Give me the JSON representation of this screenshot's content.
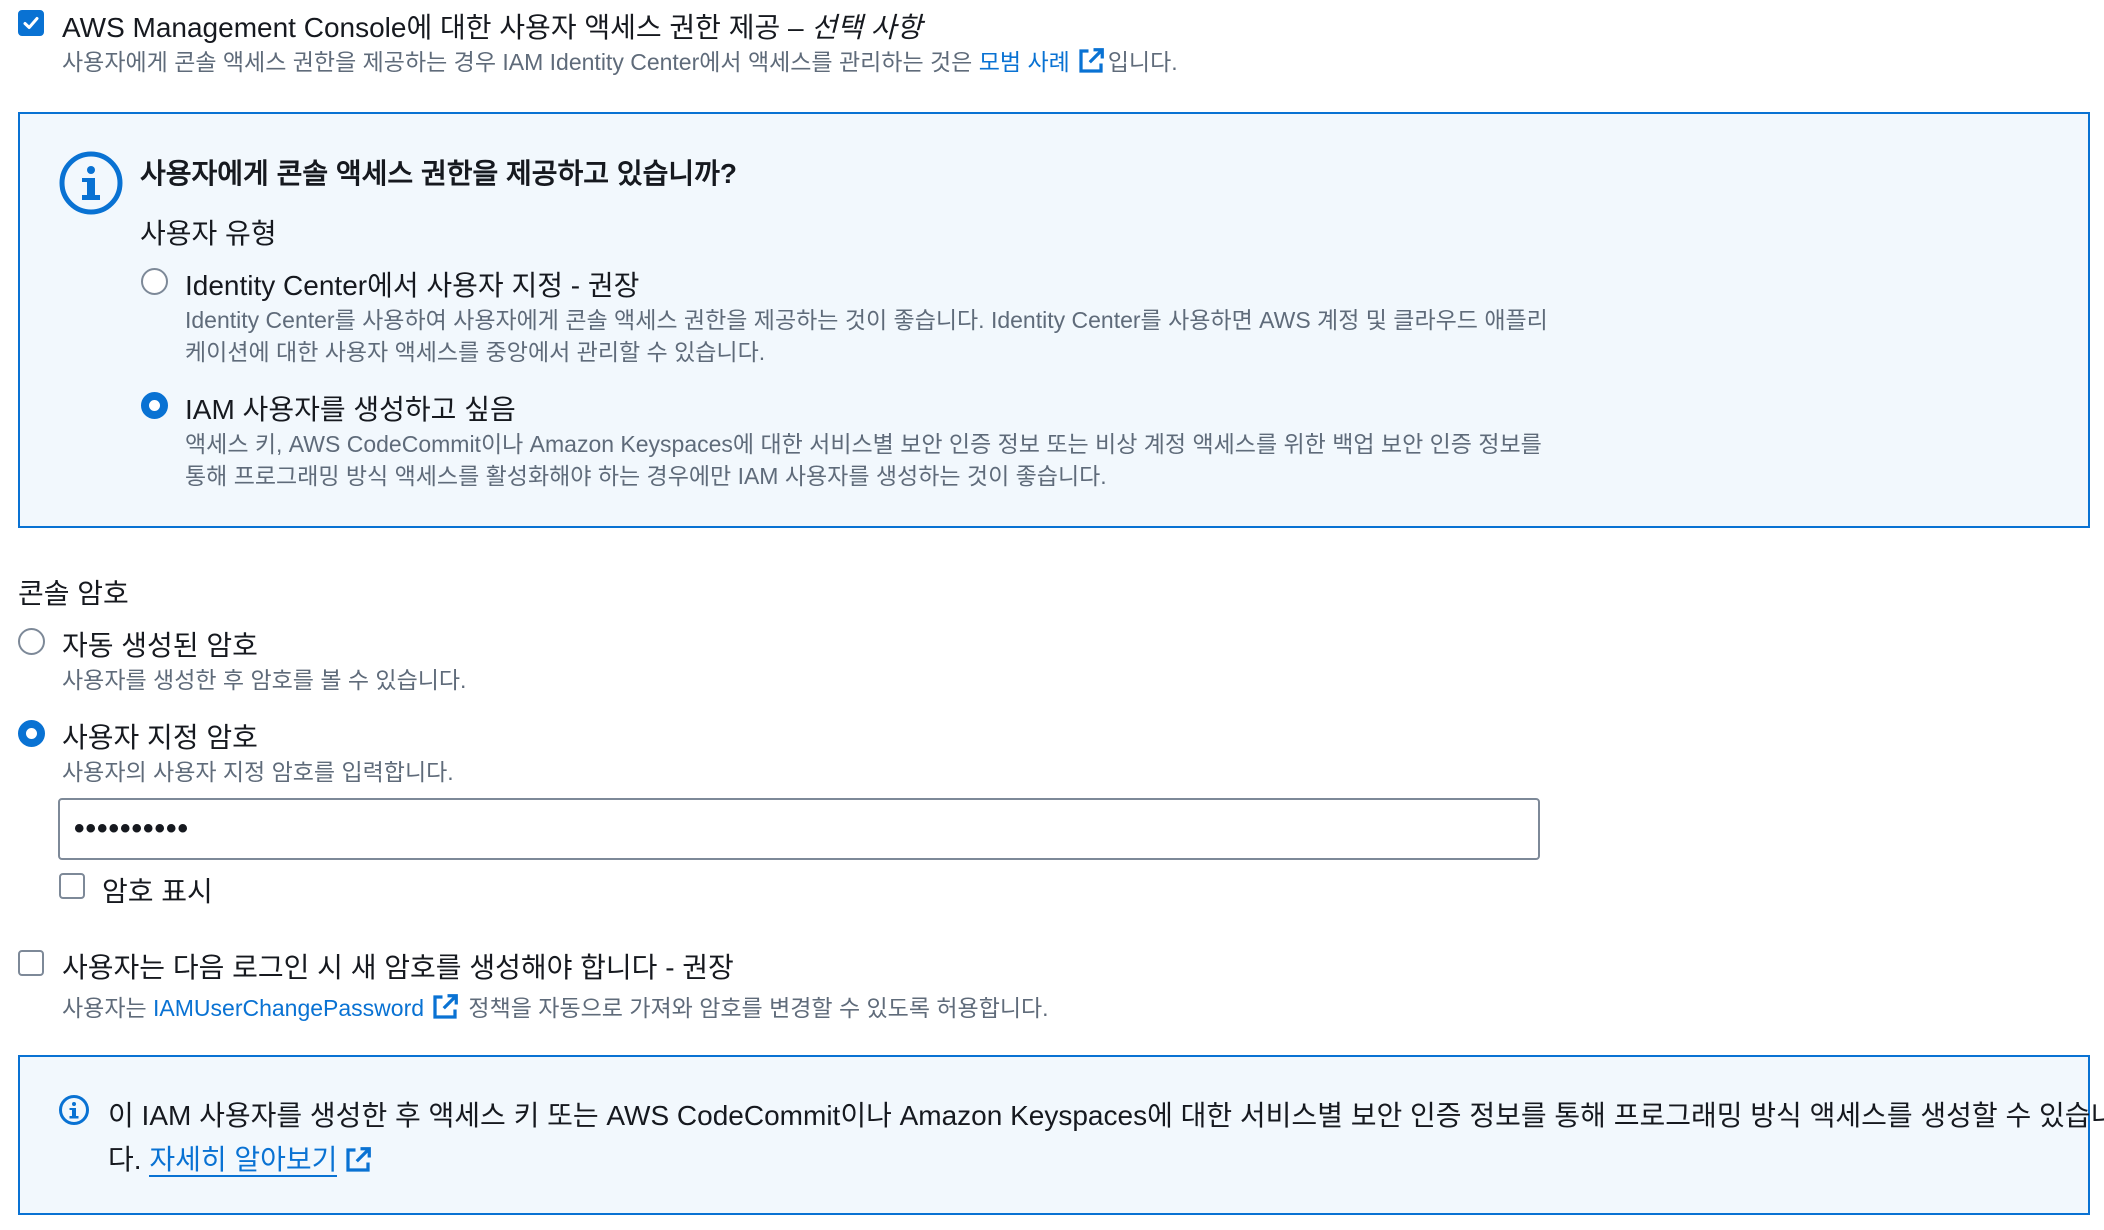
{
  "console_access": {
    "checked": true,
    "label": "AWS Management Console에 대한 사용자 액세스 권한 제공 – ",
    "label_optional": "선택 사항",
    "desc_prefix": "사용자에게 콘솔 액세스 권한을 제공하는 경우 IAM Identity Center에서 액세스를 관리하는 것은 ",
    "desc_link": "모범 사례",
    "desc_suffix": "입니다."
  },
  "info_panel": {
    "title": "사용자에게 콘솔 액세스 권한을 제공하고 있습니까?",
    "user_type_label": "사용자 유형",
    "options": [
      {
        "label": "Identity Center에서 사용자 지정 - 권장",
        "selected": false,
        "desc_line1": "Identity Center를 사용하여 사용자에게 콘솔 액세스 권한을 제공하는 것이 좋습니다. Identity Center를 사용하면 AWS 계정 및 클라우드 애플리",
        "desc_line2": "케이션에 대한 사용자 액세스를 중앙에서 관리할 수 있습니다."
      },
      {
        "label": "IAM 사용자를 생성하고 싶음",
        "selected": true,
        "desc_line1": "액세스 키, AWS CodeCommit이나 Amazon Keyspaces에 대한 서비스별 보안 인증 정보 또는 비상 계정 액세스를 위한 백업 보안 인증 정보를",
        "desc_line2": "통해 프로그래밍 방식 액세스를 활성화해야 하는 경우에만 IAM 사용자를 생성하는 것이 좋습니다."
      }
    ]
  },
  "console_password": {
    "heading": "콘솔 암호",
    "options": [
      {
        "label": "자동 생성된 암호",
        "desc": "사용자를 생성한 후 암호를 볼 수 있습니다.",
        "selected": false
      },
      {
        "label": "사용자 지정 암호",
        "desc": "사용자의 사용자 지정 암호를 입력합니다.",
        "selected": true
      }
    ],
    "password_value": "••••••••••",
    "show_password_label": "암호 표시",
    "show_password_checked": false
  },
  "require_reset": {
    "checked": false,
    "label": "사용자는 다음 로그인 시 새 암호를 생성해야 합니다 - 권장",
    "desc_prefix": "사용자는 ",
    "desc_link": "IAMUserChangePassword",
    "desc_suffix": " 정책을 자동으로 가져와 암호를 변경할 수 있도록 허용합니다."
  },
  "bottom_info": {
    "text_line1": "이 IAM 사용자를 생성한 후 액세스 키 또는 AWS CodeCommit이나 Amazon Keyspaces에 대한 서비스별 보안 인증 정보를 통해 프로그래밍 방식 액세스를 생성할 수 있습니",
    "text_line2_prefix": "다. ",
    "link": "자세히 알아보기"
  },
  "colors": {
    "accent": "#0972d3",
    "info_bg": "#f2f8fd",
    "text": "#16191f",
    "secondary_text": "#5f6b7a",
    "border": "#7d8998"
  }
}
